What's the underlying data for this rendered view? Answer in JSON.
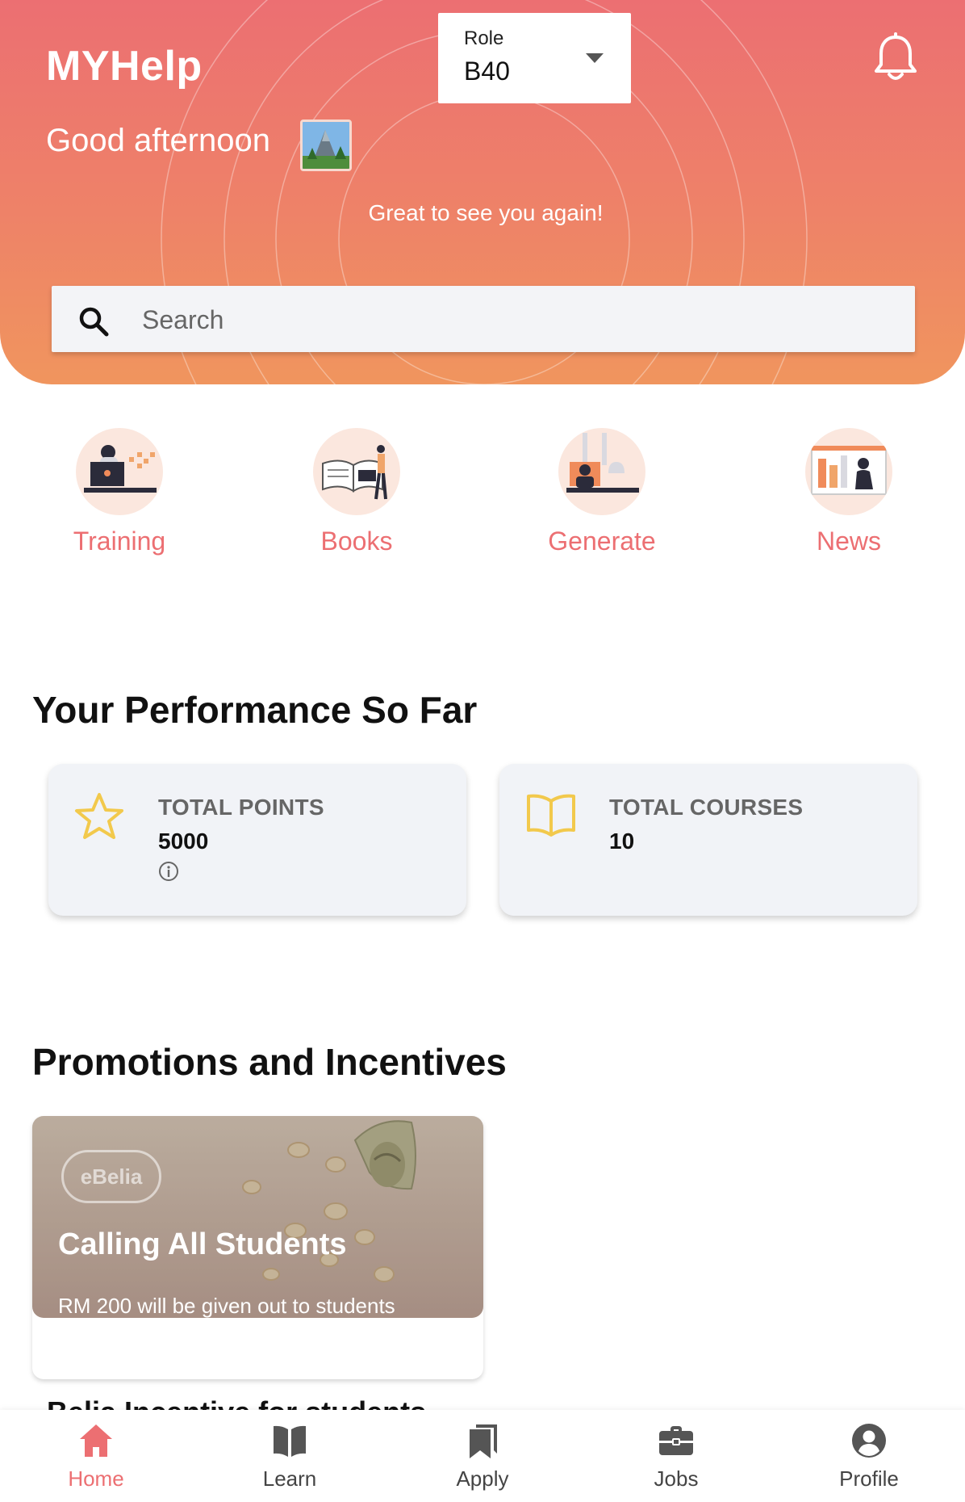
{
  "header": {
    "app_title": "MYHelp",
    "greeting": "Good afternoon",
    "welcome_message": "Great to see you again!",
    "role": {
      "label": "Role",
      "value": "B40"
    },
    "search": {
      "placeholder": "Search",
      "value": ""
    }
  },
  "categories": [
    {
      "label": "Training",
      "icon": "person-at-computer-illustration"
    },
    {
      "label": "Books",
      "icon": "open-book-illustration"
    },
    {
      "label": "Generate",
      "icon": "video-call-illustration"
    },
    {
      "label": "News",
      "icon": "news-board-illustration"
    }
  ],
  "performance": {
    "title": "Your Performance So Far",
    "total_points": {
      "label": "TOTAL POINTS",
      "value": "5000",
      "icon": "star-icon"
    },
    "total_courses": {
      "label": "TOTAL COURSES",
      "value": "10",
      "icon": "book-icon"
    }
  },
  "promotions": {
    "title": "Promotions and Incentives",
    "cards": [
      {
        "badge": "eBelia",
        "title": "Calling All Students",
        "subtitle": "RM 200 will be given out to students"
      }
    ],
    "next_title_peek": "Belia Incentive for students"
  },
  "bottom_nav": {
    "active": "Home",
    "items": [
      {
        "label": "Home",
        "icon": "home-icon"
      },
      {
        "label": "Learn",
        "icon": "book-icon"
      },
      {
        "label": "Apply",
        "icon": "bookmarks-icon"
      },
      {
        "label": "Jobs",
        "icon": "briefcase-icon"
      },
      {
        "label": "Profile",
        "icon": "account-circle-icon"
      }
    ]
  },
  "colors": {
    "accent": "#ec6f72",
    "header_gradient_start": "#ec6f72",
    "header_gradient_end": "#f0955e",
    "card_background": "#f1f3f7",
    "icon_gold": "#f2c94c"
  }
}
